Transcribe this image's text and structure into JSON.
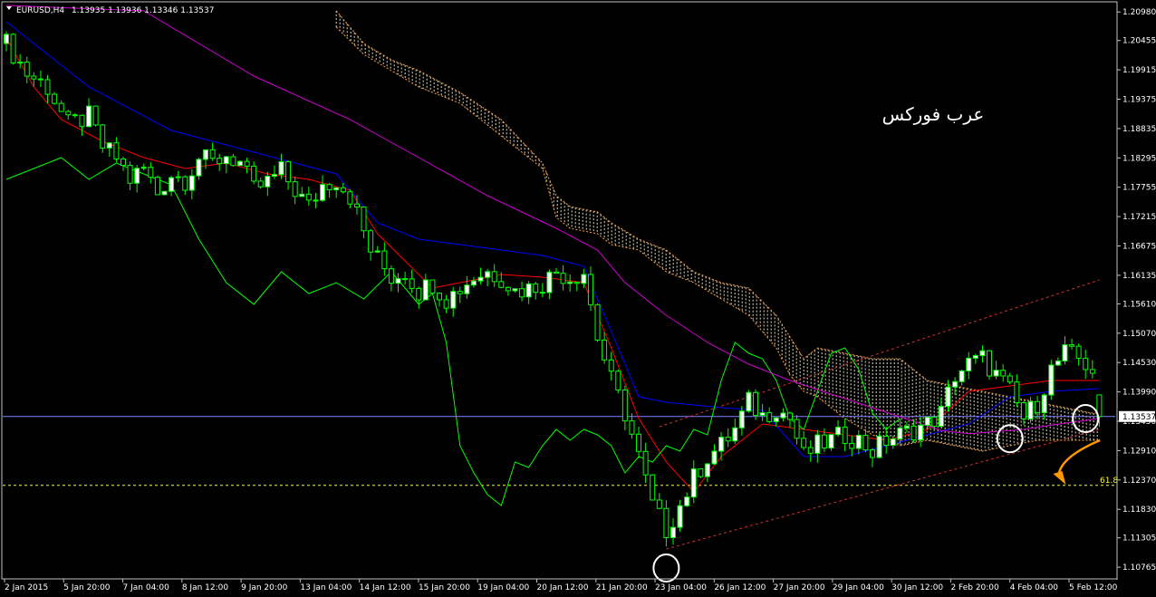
{
  "header": {
    "title": "EURUSD,H4",
    "quote": "1.13935 1.13936 1.13346 1.13537"
  },
  "watermark": "عرب فوركس",
  "colors": {
    "background": "#000000",
    "frame": "#c0c0c0",
    "bull_candle": "#ffffff",
    "bear_candle": "#000000",
    "candle_outline": "#00ff00",
    "tenkan": "#ff0000",
    "kijun": "#0000ff",
    "chikou": "#00ff00",
    "ma": "#d000d0",
    "cloud_hatch": "#fff0c0",
    "cloud_border": "#ffa040",
    "bid_line": "#8080ff",
    "fibo": "#ffff00",
    "channel": "#d03030",
    "annotation_circle": "#ffffff",
    "arrow": "#ff9900"
  },
  "chart_data": {
    "type": "candlestick",
    "symbol": "EURUSD",
    "timeframe": "H4",
    "ohlc_header": {
      "open": 1.13935,
      "high": 1.13936,
      "low": 1.13346,
      "close": 1.13537
    },
    "ylim": [
      1.1055,
      1.2115
    ],
    "y_ticks": [
      "1.20980",
      "1.20455",
      "1.19915",
      "1.19375",
      "1.18835",
      "1.18295",
      "1.17755",
      "1.17215",
      "1.16675",
      "1.16135",
      "1.15610",
      "1.15070",
      "1.14530",
      "1.13990",
      "1.13450",
      "1.12910",
      "1.12370",
      "1.11830",
      "1.11305",
      "1.10765"
    ],
    "x_ticks": [
      "2 Jan 2015",
      "5 Jan 20:00",
      "7 Jan 04:00",
      "8 Jan 12:00",
      "9 Jan 20:00",
      "13 Jan 04:00",
      "14 Jan 12:00",
      "15 Jan 20:00",
      "19 Jan 04:00",
      "20 Jan 12:00",
      "21 Jan 20:00",
      "23 Jan 04:00",
      "26 Jan 12:00",
      "27 Jan 20:00",
      "29 Jan 04:00",
      "30 Jan 12:00",
      "2 Feb 20:00",
      "4 Feb 04:00",
      "5 Feb 12:00"
    ],
    "current_price": {
      "value": 1.13537,
      "label": "1.13537"
    },
    "fibo_level": {
      "value": 1.1227,
      "label": "61.8"
    },
    "close_path": [
      [
        0,
        1.204
      ],
      [
        3,
        1.1985
      ],
      [
        6,
        1.196
      ],
      [
        9,
        1.189
      ],
      [
        12,
        1.1905
      ],
      [
        14,
        1.185
      ],
      [
        16,
        1.183
      ],
      [
        18,
        1.179
      ],
      [
        20,
        1.181
      ],
      [
        22,
        1.1765
      ],
      [
        24,
        1.18
      ],
      [
        26,
        1.179
      ],
      [
        28,
        1.183
      ],
      [
        30,
        1.182
      ],
      [
        32,
        1.1835
      ],
      [
        34,
        1.182
      ],
      [
        36,
        1.177
      ],
      [
        38,
        1.1785
      ],
      [
        40,
        1.1805
      ],
      [
        42,
        1.177
      ],
      [
        44,
        1.174
      ],
      [
        46,
        1.178
      ],
      [
        48,
        1.179
      ],
      [
        50,
        1.176
      ],
      [
        53,
        1.166
      ],
      [
        56,
        1.161
      ],
      [
        58,
        1.162
      ],
      [
        60,
        1.1585
      ],
      [
        62,
        1.16
      ],
      [
        64,
        1.157
      ],
      [
        66,
        1.159
      ],
      [
        68,
        1.161
      ],
      [
        70,
        1.162
      ],
      [
        72,
        1.161
      ],
      [
        74,
        1.1585
      ],
      [
        76,
        1.159
      ],
      [
        78,
        1.16
      ],
      [
        80,
        1.162
      ],
      [
        82,
        1.161
      ],
      [
        84,
        1.162
      ],
      [
        86,
        1.15
      ],
      [
        88,
        1.142
      ],
      [
        90,
        1.136
      ],
      [
        92,
        1.128
      ],
      [
        94,
        1.119
      ],
      [
        96,
        1.1145
      ],
      [
        98,
        1.119
      ],
      [
        100,
        1.124
      ],
      [
        102,
        1.128
      ],
      [
        104,
        1.13
      ],
      [
        106,
        1.133
      ],
      [
        108,
        1.138
      ],
      [
        110,
        1.1355
      ],
      [
        112,
        1.137
      ],
      [
        114,
        1.135
      ],
      [
        116,
        1.128
      ],
      [
        118,
        1.13
      ],
      [
        120,
        1.131
      ],
      [
        122,
        1.132
      ],
      [
        124,
        1.131
      ],
      [
        126,
        1.129
      ],
      [
        128,
        1.131
      ],
      [
        130,
        1.132
      ],
      [
        132,
        1.133
      ],
      [
        134,
        1.134
      ],
      [
        136,
        1.136
      ],
      [
        138,
        1.143
      ],
      [
        140,
        1.145
      ],
      [
        142,
        1.146
      ],
      [
        144,
        1.143
      ],
      [
        146,
        1.14
      ],
      [
        148,
        1.135
      ],
      [
        150,
        1.138
      ],
      [
        152,
        1.144
      ],
      [
        154,
        1.147
      ],
      [
        156,
        1.146
      ],
      [
        158,
        1.144
      ],
      [
        159,
        1.13537
      ]
    ],
    "series": [
      {
        "name": "Tenkan-sen",
        "points": [
          [
            0,
            1.205
          ],
          [
            4,
            1.196
          ],
          [
            8,
            1.19
          ],
          [
            14,
            1.186
          ],
          [
            20,
            1.183
          ],
          [
            26,
            1.181
          ],
          [
            32,
            1.182
          ],
          [
            38,
            1.18
          ],
          [
            44,
            1.179
          ],
          [
            50,
            1.177
          ],
          [
            54,
            1.169
          ],
          [
            58,
            1.164
          ],
          [
            62,
            1.159
          ],
          [
            66,
            1.16
          ],
          [
            72,
            1.1615
          ],
          [
            78,
            1.161
          ],
          [
            84,
            1.16
          ],
          [
            88,
            1.148
          ],
          [
            92,
            1.135
          ],
          [
            96,
            1.127
          ],
          [
            100,
            1.1215
          ],
          [
            104,
            1.128
          ],
          [
            110,
            1.134
          ],
          [
            116,
            1.133
          ],
          [
            122,
            1.132
          ],
          [
            128,
            1.131
          ],
          [
            134,
            1.133
          ],
          [
            140,
            1.14
          ],
          [
            146,
            1.141
          ],
          [
            152,
            1.142
          ],
          [
            159,
            1.142
          ]
        ]
      },
      {
        "name": "Kijun-sen",
        "points": [
          [
            0,
            1.208
          ],
          [
            6,
            1.202
          ],
          [
            12,
            1.196
          ],
          [
            18,
            1.192
          ],
          [
            24,
            1.188
          ],
          [
            30,
            1.186
          ],
          [
            36,
            1.184
          ],
          [
            42,
            1.182
          ],
          [
            48,
            1.18
          ],
          [
            54,
            1.171
          ],
          [
            60,
            1.168
          ],
          [
            66,
            1.167
          ],
          [
            72,
            1.166
          ],
          [
            78,
            1.165
          ],
          [
            84,
            1.163
          ],
          [
            88,
            1.151
          ],
          [
            92,
            1.139
          ],
          [
            96,
            1.138
          ],
          [
            104,
            1.137
          ],
          [
            110,
            1.1365
          ],
          [
            116,
            1.128
          ],
          [
            122,
            1.128
          ],
          [
            128,
            1.13
          ],
          [
            134,
            1.132
          ],
          [
            140,
            1.134
          ],
          [
            146,
            1.139
          ],
          [
            152,
            1.14
          ],
          [
            159,
            1.1405
          ]
        ]
      },
      {
        "name": "Chikou Span",
        "points": [
          [
            0,
            1.179
          ],
          [
            4,
            1.181
          ],
          [
            8,
            1.183
          ],
          [
            12,
            1.179
          ],
          [
            16,
            1.182
          ],
          [
            20,
            1.18
          ],
          [
            24,
            1.178
          ],
          [
            28,
            1.168
          ],
          [
            32,
            1.16
          ],
          [
            36,
            1.156
          ],
          [
            40,
            1.162
          ],
          [
            44,
            1.158
          ],
          [
            48,
            1.16
          ],
          [
            52,
            1.157
          ],
          [
            56,
            1.162
          ],
          [
            60,
            1.156
          ],
          [
            62,
            1.158
          ],
          [
            64,
            1.149
          ],
          [
            66,
            1.13
          ],
          [
            68,
            1.125
          ],
          [
            70,
            1.121
          ],
          [
            72,
            1.119
          ],
          [
            74,
            1.127
          ],
          [
            76,
            1.126
          ],
          [
            78,
            1.13
          ],
          [
            80,
            1.133
          ],
          [
            82,
            1.131
          ],
          [
            84,
            1.133
          ],
          [
            86,
            1.132
          ],
          [
            88,
            1.13
          ],
          [
            90,
            1.125
          ],
          [
            92,
            1.128
          ],
          [
            94,
            1.127
          ],
          [
            96,
            1.13
          ],
          [
            98,
            1.129
          ],
          [
            100,
            1.133
          ],
          [
            102,
            1.132
          ],
          [
            104,
            1.142
          ],
          [
            106,
            1.149
          ],
          [
            108,
            1.147
          ],
          [
            110,
            1.146
          ],
          [
            112,
            1.142
          ],
          [
            114,
            1.135
          ],
          [
            116,
            1.133
          ],
          [
            118,
            1.14
          ],
          [
            120,
            1.147
          ],
          [
            122,
            1.148
          ],
          [
            124,
            1.144
          ],
          [
            126,
            1.136
          ],
          [
            128,
            1.133
          ],
          [
            130,
            1.135
          ]
        ]
      },
      {
        "name": "Moving Average",
        "points": [
          [
            0,
            1.211
          ],
          [
            20,
            1.21
          ],
          [
            36,
            1.198
          ],
          [
            50,
            1.19
          ],
          [
            60,
            1.183
          ],
          [
            70,
            1.176
          ],
          [
            80,
            1.17
          ],
          [
            86,
            1.166
          ],
          [
            90,
            1.16
          ],
          [
            96,
            1.154
          ],
          [
            102,
            1.149
          ],
          [
            108,
            1.145
          ],
          [
            114,
            1.142
          ],
          [
            120,
            1.1395
          ],
          [
            126,
            1.137
          ],
          [
            132,
            1.1345
          ],
          [
            136,
            1.1328
          ],
          [
            140,
            1.1322
          ],
          [
            144,
            1.1326
          ],
          [
            148,
            1.133
          ],
          [
            152,
            1.1338
          ],
          [
            159,
            1.135
          ]
        ]
      }
    ],
    "cloud": {
      "upper": [
        [
          48,
          1.21
        ],
        [
          52,
          1.204
        ],
        [
          56,
          1.201
        ],
        [
          60,
          1.199
        ],
        [
          66,
          1.195
        ],
        [
          72,
          1.19
        ],
        [
          78,
          1.182
        ],
        [
          80,
          1.176
        ],
        [
          82,
          1.174
        ],
        [
          86,
          1.173
        ],
        [
          88,
          1.171
        ],
        [
          92,
          1.168
        ],
        [
          96,
          1.166
        ],
        [
          100,
          1.162
        ],
        [
          104,
          1.16
        ],
        [
          108,
          1.159
        ],
        [
          112,
          1.154
        ],
        [
          114,
          1.15
        ],
        [
          116,
          1.146
        ],
        [
          118,
          1.148
        ],
        [
          122,
          1.147
        ],
        [
          126,
          1.146
        ],
        [
          130,
          1.146
        ],
        [
          134,
          1.142
        ],
        [
          138,
          1.141
        ],
        [
          142,
          1.14
        ],
        [
          146,
          1.139
        ],
        [
          150,
          1.138
        ],
        [
          154,
          1.137
        ],
        [
          158,
          1.136
        ],
        [
          159,
          1.136
        ]
      ],
      "lower": [
        [
          48,
          1.207
        ],
        [
          52,
          1.202
        ],
        [
          56,
          1.199
        ],
        [
          60,
          1.196
        ],
        [
          66,
          1.193
        ],
        [
          72,
          1.187
        ],
        [
          78,
          1.181
        ],
        [
          80,
          1.172
        ],
        [
          82,
          1.17
        ],
        [
          86,
          1.169
        ],
        [
          88,
          1.167
        ],
        [
          92,
          1.166
        ],
        [
          96,
          1.162
        ],
        [
          100,
          1.16
        ],
        [
          104,
          1.157
        ],
        [
          108,
          1.154
        ],
        [
          112,
          1.148
        ],
        [
          114,
          1.143
        ],
        [
          116,
          1.14
        ],
        [
          118,
          1.139
        ],
        [
          122,
          1.135
        ],
        [
          126,
          1.132
        ],
        [
          130,
          1.13
        ],
        [
          134,
          1.131
        ],
        [
          138,
          1.13
        ],
        [
          142,
          1.129
        ],
        [
          146,
          1.13
        ],
        [
          150,
          1.131
        ],
        [
          154,
          1.131
        ],
        [
          158,
          1.131
        ],
        [
          159,
          1.131
        ]
      ]
    },
    "channel_lines": [
      {
        "from": [
          95,
          1.1335
        ],
        "to": [
          159,
          1.1605
        ]
      },
      {
        "from": [
          96,
          1.111
        ],
        "to": [
          159,
          1.133
        ]
      }
    ],
    "annotations": [
      {
        "type": "circle",
        "at": [
          96,
          1.1075
        ]
      },
      {
        "type": "circle",
        "at": [
          146,
          1.1313
        ]
      },
      {
        "type": "circle",
        "at": [
          157,
          1.135
        ]
      },
      {
        "type": "arrow",
        "from": [
          157,
          1.131
        ],
        "to": [
          154,
          1.123
        ]
      }
    ]
  }
}
